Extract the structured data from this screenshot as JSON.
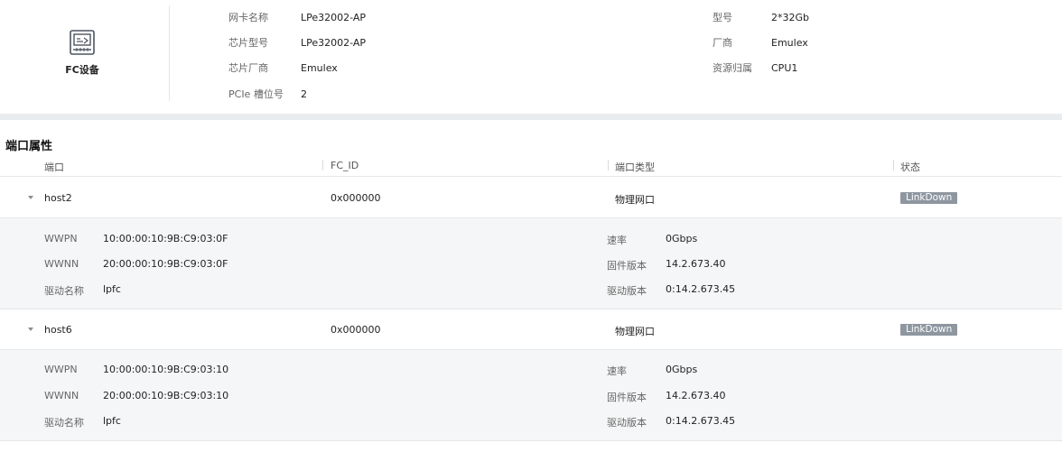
{
  "device": {
    "title": "FC设备",
    "icon": "network-card-icon",
    "fields_left": [
      {
        "key": "网卡名称",
        "value": "LPe32002-AP"
      },
      {
        "key": "芯片型号",
        "value": "LPe32002-AP"
      },
      {
        "key": "芯片厂商",
        "value": "Emulex"
      },
      {
        "key": "PCIe 槽位号",
        "value": "2"
      }
    ],
    "fields_right": [
      {
        "key": "型号",
        "value": "2*32Gb"
      },
      {
        "key": "厂商",
        "value": "Emulex"
      },
      {
        "key": "资源归属",
        "value": "CPU1"
      }
    ]
  },
  "ports": {
    "title": "端口属性",
    "columns": [
      "端口",
      "FC_ID",
      "端口类型",
      "状态"
    ],
    "rows": [
      {
        "port": "host2",
        "fc_id": "0x000000",
        "type": "物理网口",
        "status": "LinkDown",
        "detail_left": [
          {
            "key": "WWPN",
            "value": "10:00:00:10:9B:C9:03:0F"
          },
          {
            "key": "WWNN",
            "value": "20:00:00:10:9B:C9:03:0F"
          },
          {
            "key": "驱动名称",
            "value": "lpfc"
          }
        ],
        "detail_right": [
          {
            "key": "速率",
            "value": "0Gbps"
          },
          {
            "key": "固件版本",
            "value": "14.2.673.40"
          },
          {
            "key": "驱动版本",
            "value": "0:14.2.673.45"
          }
        ]
      },
      {
        "port": "host6",
        "fc_id": "0x000000",
        "type": "物理网口",
        "status": "LinkDown",
        "detail_left": [
          {
            "key": "WWPN",
            "value": "10:00:00:10:9B:C9:03:10"
          },
          {
            "key": "WWNN",
            "value": "20:00:00:10:9B:C9:03:10"
          },
          {
            "key": "驱动名称",
            "value": "lpfc"
          }
        ],
        "detail_right": [
          {
            "key": "速率",
            "value": "0Gbps"
          },
          {
            "key": "固件版本",
            "value": "14.2.673.40"
          },
          {
            "key": "驱动版本",
            "value": "0:14.2.673.45"
          }
        ]
      }
    ]
  },
  "colors": {
    "badge": "#8e96a0",
    "band": "#e9ecef",
    "detail_bg": "#f5f6f7"
  }
}
